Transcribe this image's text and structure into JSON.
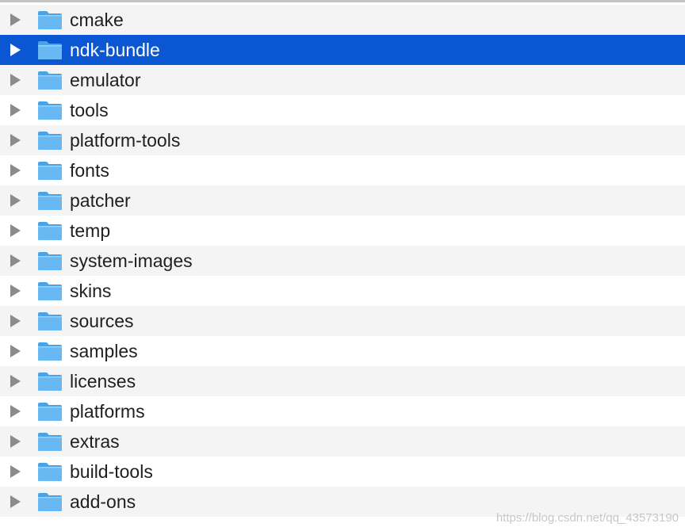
{
  "colors": {
    "selection": "#0b56d2",
    "row_alt": "#f4f4f4",
    "disclosure": "#8b8b8b",
    "folder_front": "#68b8f4",
    "folder_back": "#4aa3e6"
  },
  "folders": [
    {
      "name": "cmake",
      "selected": false,
      "icon": "folder-icon"
    },
    {
      "name": "ndk-bundle",
      "selected": true,
      "icon": "folder-icon"
    },
    {
      "name": "emulator",
      "selected": false,
      "icon": "folder-icon"
    },
    {
      "name": "tools",
      "selected": false,
      "icon": "folder-icon"
    },
    {
      "name": "platform-tools",
      "selected": false,
      "icon": "folder-icon"
    },
    {
      "name": "fonts",
      "selected": false,
      "icon": "folder-icon"
    },
    {
      "name": "patcher",
      "selected": false,
      "icon": "folder-icon"
    },
    {
      "name": "temp",
      "selected": false,
      "icon": "folder-icon"
    },
    {
      "name": "system-images",
      "selected": false,
      "icon": "folder-icon"
    },
    {
      "name": "skins",
      "selected": false,
      "icon": "folder-icon"
    },
    {
      "name": "sources",
      "selected": false,
      "icon": "folder-icon"
    },
    {
      "name": "samples",
      "selected": false,
      "icon": "folder-icon"
    },
    {
      "name": "licenses",
      "selected": false,
      "icon": "folder-icon"
    },
    {
      "name": "platforms",
      "selected": false,
      "icon": "folder-icon"
    },
    {
      "name": "extras",
      "selected": false,
      "icon": "folder-icon"
    },
    {
      "name": "build-tools",
      "selected": false,
      "icon": "folder-icon"
    },
    {
      "name": "add-ons",
      "selected": false,
      "icon": "folder-icon"
    }
  ],
  "watermark": "https://blog.csdn.net/qq_43573190"
}
